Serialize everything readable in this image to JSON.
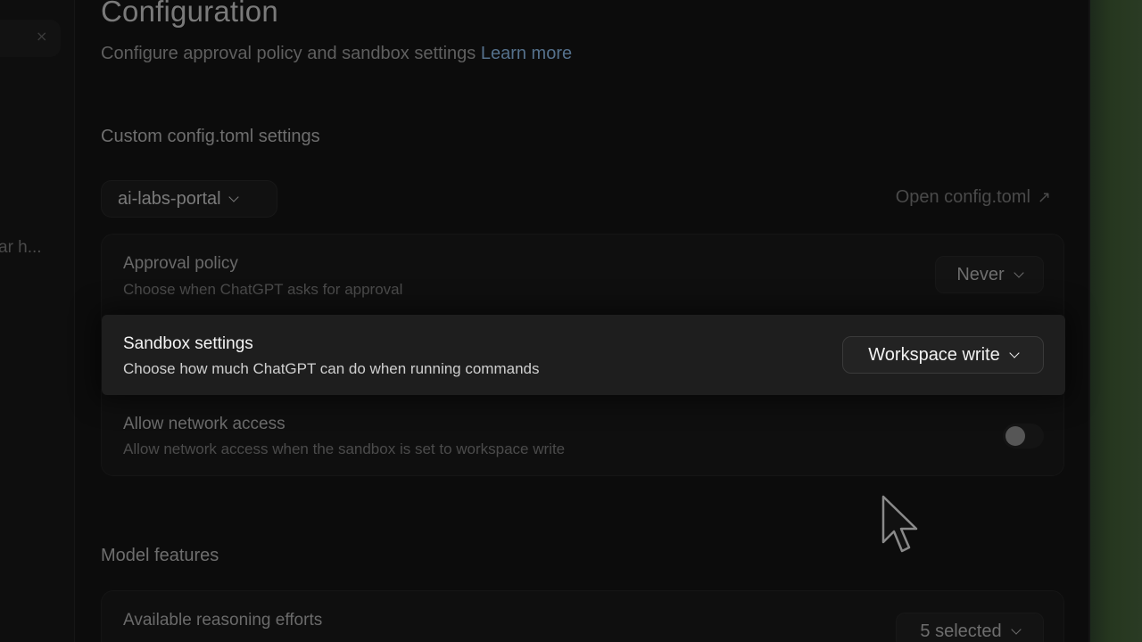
{
  "sidebar": {
    "close_glyph": "×",
    "truncated_text": "ar h..."
  },
  "page": {
    "title": "Configuration",
    "subtitle": "Configure approval policy and sandbox settings",
    "learn_more": "Learn more"
  },
  "custom_section": {
    "heading": "Custom config.toml settings",
    "project_select": "ai-labs-portal",
    "open_config": "Open config.toml",
    "open_icon": "↗",
    "rows": {
      "approval": {
        "title": "Approval policy",
        "desc": "Choose when ChatGPT asks for approval",
        "value": "Never"
      },
      "sandbox": {
        "title": "Sandbox settings",
        "desc": "Choose how much ChatGPT can do when running commands",
        "value": "Workspace write"
      },
      "network": {
        "title": "Allow network access",
        "desc": "Allow network access when the sandbox is set to workspace write",
        "enabled": false
      }
    }
  },
  "model_section": {
    "heading": "Model features",
    "reasoning": {
      "title": "Available reasoning efforts",
      "value": "5 selected"
    }
  },
  "colors": {
    "background": "#0c0c0c",
    "accent_link": "#55718c",
    "right_strip": "#2a3b24"
  }
}
